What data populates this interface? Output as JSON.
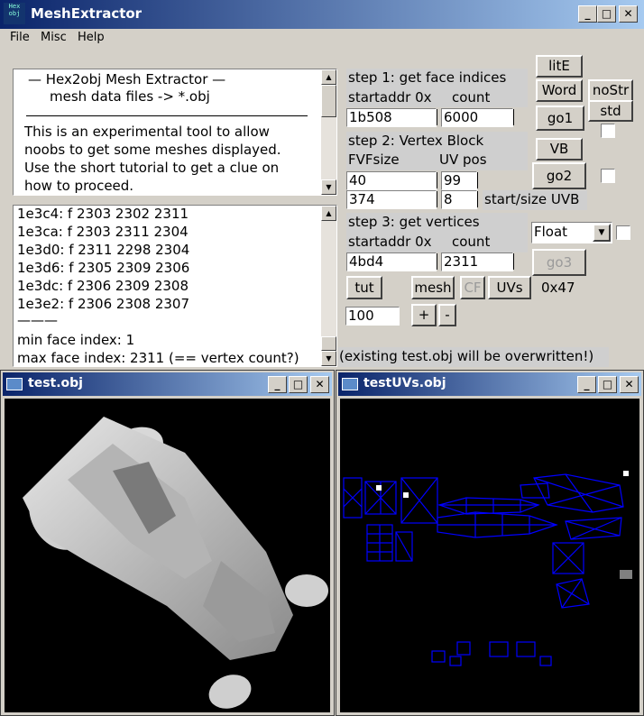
{
  "window": {
    "title": "MeshExtractor",
    "icon_text": "Hex obj",
    "minimize": "_",
    "maximize": "□",
    "close": "✕"
  },
  "menu": [
    "File",
    "Misc",
    "Help"
  ],
  "info": {
    "heading": "—   Hex2obj Mesh Extractor   —",
    "subheading": "mesh data files -> *.obj",
    "lines": [
      "This is an experimental tool to allow",
      "noobs to get some meshes displayed.",
      "Use the short tutorial to get a clue on",
      "how to proceed."
    ]
  },
  "log": {
    "lines": [
      "1e3c4: f  2303 2302 2311",
      "1e3ca: f  2303 2311 2304",
      "1e3d0: f  2311 2298 2304",
      "1e3d6: f  2305 2309 2306",
      "1e3dc: f  2306 2309 2308",
      "1e3e2: f  2306 2308 2307"
    ],
    "separator": "———",
    "min_face": "min face index: 1",
    "max_face": "max face index: 2311 (== vertex count?)"
  },
  "step1": {
    "title": "step 1: get face indices",
    "label_addr": "startaddr 0x",
    "label_count": "count",
    "addr": "1b508",
    "count": "6000"
  },
  "step2": {
    "title": "step 2: Vertex Block",
    "label_fvf": "FVFsize",
    "label_uv": "UV pos",
    "fvf": "40",
    "uvpos": "99",
    "start": "374",
    "size": "8",
    "uvb_label": "start/size UVB"
  },
  "step3": {
    "title": "step 3: get vertices",
    "label_addr": "startaddr 0x",
    "label_count": "count",
    "addr": "4bd4",
    "count": "2311",
    "type": "Float",
    "hex": "0x47"
  },
  "buttons": {
    "lite": "litE",
    "word": "Word",
    "nostr": "noStr",
    "std": "std",
    "go1": "go1",
    "vb": "VB",
    "go2": "go2",
    "go3": "go3",
    "tut": "tut",
    "mesh": "mesh",
    "cf": "CF",
    "uvs": "UVs",
    "plus": "+",
    "minus": "-"
  },
  "scale_value": "100",
  "warning": "(existing test.obj will be overwritten!)",
  "subwindows": {
    "left_title": "test.obj",
    "right_title": "testUVs.obj"
  },
  "colors": {
    "titlebar_start": "#0a246a",
    "titlebar_end": "#a6caf0",
    "uv_lines": "#0000ff"
  }
}
